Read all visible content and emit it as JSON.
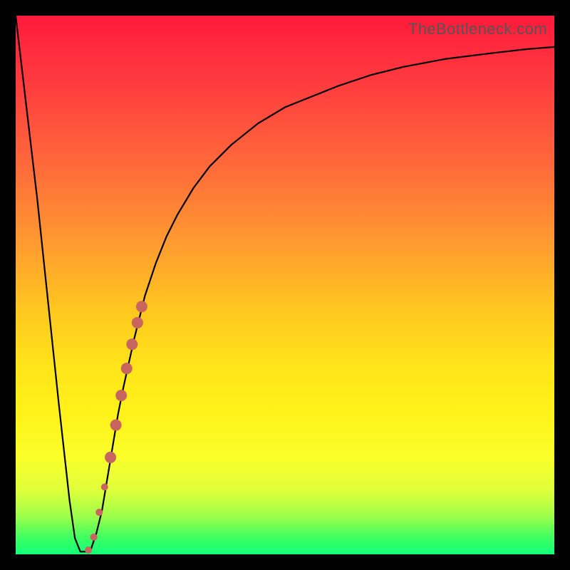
{
  "watermark": "TheBottleneck.com",
  "colors": {
    "frame": "#000000",
    "curve": "#000000",
    "marker": "#c9655f",
    "gradient_top": "#ff1a3c",
    "gradient_bottom": "#14ff7a"
  },
  "chart_data": {
    "type": "line",
    "title": "",
    "xlabel": "",
    "ylabel": "",
    "xlim": [
      0,
      100
    ],
    "ylim": [
      0,
      100
    ],
    "series": [
      {
        "name": "bottleneck-curve",
        "x": [
          0,
          4,
          8,
          10,
          11,
          12,
          13,
          14,
          15,
          16,
          17,
          18,
          19,
          20,
          22,
          24,
          26,
          28,
          30,
          33,
          36,
          40,
          45,
          50,
          55,
          60,
          66,
          72,
          80,
          88,
          95,
          100
        ],
        "y": [
          100,
          66,
          28,
          10,
          3,
          0.5,
          0.5,
          1,
          4,
          8,
          14,
          20,
          26,
          31,
          40,
          48,
          54,
          59,
          63,
          68,
          72,
          76,
          80,
          83,
          85,
          87,
          89,
          90.5,
          92,
          93,
          93.8,
          94.2
        ]
      }
    ],
    "markers": {
      "name": "highlighted-points",
      "color": "#c9655f",
      "items": [
        {
          "x": 13.5,
          "y": 0.8,
          "r": 5
        },
        {
          "x": 14.5,
          "y": 3.2,
          "r": 5
        },
        {
          "x": 15.5,
          "y": 7.8,
          "r": 5
        },
        {
          "x": 16.5,
          "y": 12.5,
          "r": 5
        },
        {
          "x": 17.6,
          "y": 18.0,
          "r": 8
        },
        {
          "x": 18.6,
          "y": 24.0,
          "r": 8
        },
        {
          "x": 19.6,
          "y": 29.5,
          "r": 8
        },
        {
          "x": 20.6,
          "y": 34.5,
          "r": 8
        },
        {
          "x": 21.6,
          "y": 39.0,
          "r": 8
        },
        {
          "x": 22.6,
          "y": 43.0,
          "r": 8
        },
        {
          "x": 23.4,
          "y": 46.0,
          "r": 8
        }
      ]
    }
  }
}
